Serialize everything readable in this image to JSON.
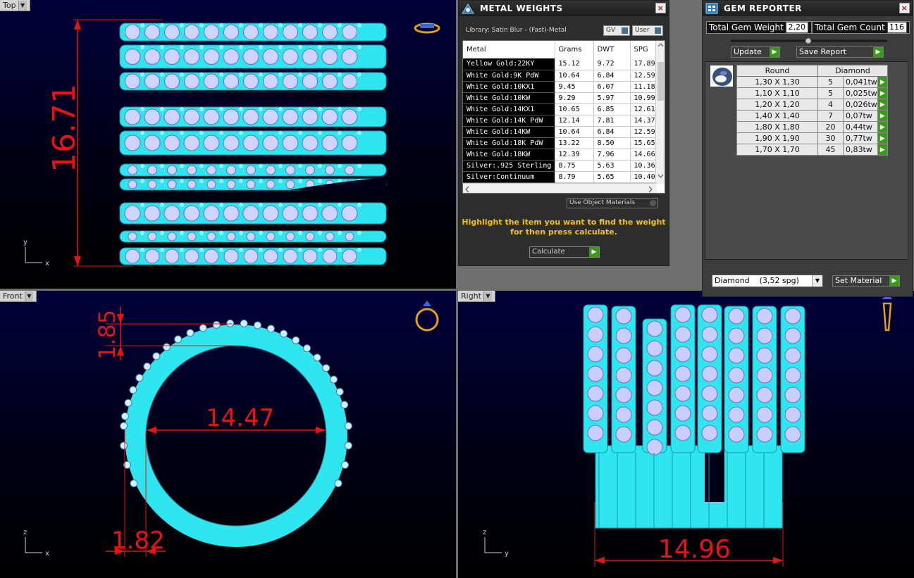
{
  "viewports": {
    "top": {
      "label": "Top",
      "dimension": "16.71",
      "axis_v": "y",
      "axis_h": "x"
    },
    "front": {
      "label": "Front",
      "dim_top": "1.85",
      "dim_inner": "14.47",
      "dim_bottom": "1.82",
      "axis_v": "z",
      "axis_h": "x"
    },
    "right": {
      "label": "Right",
      "dimension": "14.96",
      "axis_v": "z",
      "axis_h": "y"
    }
  },
  "metal_weights": {
    "title": "METAL WEIGHTS",
    "close": "×",
    "library": "Library: Satin Blur - (Fast)-Metal",
    "btn_gv": "GV",
    "btn_user": "User",
    "columns": [
      "Metal",
      "Grams",
      "DWT",
      "SPG"
    ],
    "rows": [
      {
        "metal": "Yellow Gold:22KY",
        "grams": "15.12",
        "dwt": "9.72",
        "spg": "17.89"
      },
      {
        "metal": "White Gold:9K PdW",
        "grams": "10.64",
        "dwt": "6.84",
        "spg": "12.59"
      },
      {
        "metal": "White Gold:10KX1",
        "grams": "9.45",
        "dwt": "6.07",
        "spg": "11.18"
      },
      {
        "metal": "White Gold:10KW",
        "grams": "9.29",
        "dwt": "5.97",
        "spg": "10.99"
      },
      {
        "metal": "White Gold:14KX1",
        "grams": "10.65",
        "dwt": "6.85",
        "spg": "12.61"
      },
      {
        "metal": "White Gold:14K PdW",
        "grams": "12.14",
        "dwt": "7.81",
        "spg": "14.37"
      },
      {
        "metal": "White Gold:14KW",
        "grams": "10.64",
        "dwt": "6.84",
        "spg": "12.59"
      },
      {
        "metal": "White Gold:18K PdW",
        "grams": "13.22",
        "dwt": "8.50",
        "spg": "15.65"
      },
      {
        "metal": "White Gold:18KW",
        "grams": "12.39",
        "dwt": "7.96",
        "spg": "14.66"
      },
      {
        "metal": "Silver:.925 Sterling",
        "grams": "8.75",
        "dwt": "5.63",
        "spg": "10.36"
      },
      {
        "metal": "Silver:Continuum",
        "grams": "8.79",
        "dwt": "5.65",
        "spg": "10.40"
      }
    ],
    "use_object_materials": "Use Object Materials",
    "hint_line1": "Highlight the item you want to find the weight",
    "hint_line2": "for then press calculate.",
    "calculate": "Calculate"
  },
  "gem_reporter": {
    "title": "GEM REPORTER",
    "close": "×",
    "total_weight_label": "Total Gem Weight",
    "total_weight": "2,20",
    "total_count_label": "Total Gem Count",
    "total_count": "116",
    "update": "Update",
    "save_report": "Save Report",
    "col_shape": "Round",
    "col_type": "Diamond",
    "rows": [
      {
        "size": "1,30 X 1,30",
        "count": "5",
        "weight": "0,041tw"
      },
      {
        "size": "1,10 X 1,10",
        "count": "5",
        "weight": "0,025tw"
      },
      {
        "size": "1,20 X 1,20",
        "count": "4",
        "weight": "0,026tw"
      },
      {
        "size": "1,40 X 1,40",
        "count": "7",
        "weight": "0,07tw"
      },
      {
        "size": "1,80 X 1,80",
        "count": "20",
        "weight": "0,44tw"
      },
      {
        "size": "1,90 X 1,90",
        "count": "30",
        "weight": "0,77tw"
      },
      {
        "size": "1,70 X 1,70",
        "count": "45",
        "weight": "0,83tw"
      }
    ],
    "material_select": "Diamond    (3,52 spg)",
    "set_material": "Set Material"
  },
  "colors": {
    "model": "#2fe6f0",
    "dimension": "#e61414",
    "hint": "#f2c20c",
    "go": "#3b9a1e"
  }
}
